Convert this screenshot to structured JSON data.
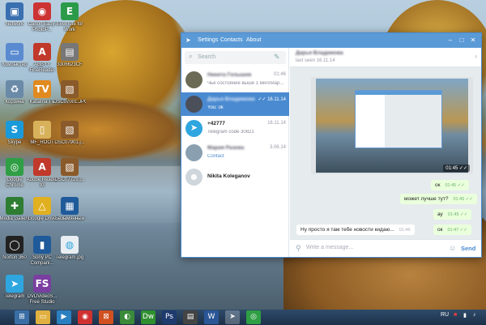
{
  "desktop": {
    "icons": [
      {
        "label": "Network",
        "color": "#3a6fb0",
        "glyph": "▣"
      },
      {
        "label": "Canon Easy-PhotoP...",
        "color": "#c33",
        "glyph": "◉"
      },
      {
        "label": "Evernote for Work",
        "color": "#2b9b4a",
        "glyph": "E"
      },
      {
        "label": "Компьютер",
        "color": "#5a8ad0",
        "glyph": "▭"
      },
      {
        "label": "ABBYY FineReader",
        "color": "#c0392b",
        "glyph": "A"
      },
      {
        "label": "3306623CF",
        "color": "#777",
        "glyph": "▤"
      },
      {
        "label": "Корзина",
        "color": "#6a8aa8",
        "glyph": "♻"
      },
      {
        "label": "Katalina TV",
        "color": "#e08a20",
        "glyph": "TV"
      },
      {
        "label": "DSC07001.JPG",
        "color": "#8a5a2a",
        "glyph": "▧"
      },
      {
        "label": "Skype",
        "color": "#1a9ad9",
        "glyph": "S"
      },
      {
        "label": "MF_ROOT",
        "color": "#d8b25a",
        "glyph": "▯"
      },
      {
        "label": "DSC07901.j...",
        "color": "#8a5a2a",
        "glyph": "▧"
      },
      {
        "label": "Google Chrome",
        "color": "#2f9e44",
        "glyph": "◎"
      },
      {
        "label": "Adobe Reader XI",
        "color": "#c0392b",
        "glyph": "A"
      },
      {
        "label": "DSC07729.j...",
        "color": "#8a5a2a",
        "glyph": "▧"
      },
      {
        "label": "Media Gallery",
        "color": "#2e7d32",
        "glyph": "✚"
      },
      {
        "label": "Google Drive",
        "color": "#e0b020",
        "glyph": "△"
      },
      {
        "label": "Безымянный",
        "color": "#1f5a9a",
        "glyph": "▦"
      },
      {
        "label": "Norton 360",
        "color": "#222",
        "glyph": "◯"
      },
      {
        "label": "Sony PC Compani...",
        "color": "#1f5a9a",
        "glyph": "▮"
      },
      {
        "label": "Telegram.jpg",
        "color": "#e9eef3",
        "glyph": "◍"
      },
      {
        "label": "Telegram",
        "color": "#2ea6e0",
        "glyph": "➤"
      },
      {
        "label": "DVDVideoS... Free Studio",
        "color": "#7a3fa0",
        "glyph": "FS"
      }
    ]
  },
  "window": {
    "menu": [
      "Settings",
      "Contacts",
      "About"
    ],
    "controls": [
      "–",
      "□",
      "✕"
    ],
    "search_placeholder": "Search",
    "chats": [
      {
        "name": "Никита Голышев",
        "preview": "Чье состояние выше 1 миллиар...",
        "time": "01:46",
        "avatar": "#6b6b55"
      },
      {
        "name": "Дарья Владимова",
        "preview": "You: ok",
        "time": "16.11.14",
        "avatar": "#4a4f5a"
      },
      {
        "name": "+42777",
        "preview": "Telegram code 30821",
        "time": "16.11.14",
        "avatar": "#2ea6e0"
      },
      {
        "name": "Мария Разова",
        "preview": "Contact",
        "time": "3.06.14",
        "avatar": "#8aa0b0"
      },
      {
        "name": "Nikita Koleganov",
        "preview": "",
        "time": "",
        "avatar": "#cfd6dc"
      }
    ],
    "active_chat": {
      "name": "Дарья Владимова",
      "status": "last seen 16.11.14"
    },
    "messages": [
      {
        "text": "",
        "time": "01:45",
        "type": "photo"
      },
      {
        "text": "ок",
        "time": "01:45",
        "type": "out"
      },
      {
        "text": "может лучше тут?",
        "time": "01:45",
        "type": "out"
      },
      {
        "text": "ау",
        "time": "01:45",
        "type": "out"
      },
      {
        "text": "Ну просто я там тебе новости кидаю...",
        "time": "01:46",
        "type": "in"
      },
      {
        "text": "ок",
        "time": "01:47",
        "type": "out"
      }
    ],
    "composer": {
      "placeholder": "Write a message...",
      "send_label": "Send"
    }
  },
  "taskbar": {
    "buttons": [
      {
        "glyph": "⊞",
        "color": "#3a6ea5"
      },
      {
        "glyph": "▭",
        "color": "#e0b040"
      },
      {
        "glyph": "▶",
        "color": "#2a7fc0"
      },
      {
        "glyph": "◉",
        "color": "#d03030"
      },
      {
        "glyph": "⊠",
        "color": "#d05020"
      },
      {
        "glyph": "◐",
        "color": "#3a8a3a"
      },
      {
        "glyph": "Dw",
        "color": "#2f8f2f"
      },
      {
        "glyph": "Ps",
        "color": "#1e3a6e"
      },
      {
        "glyph": "▤",
        "color": "#444"
      },
      {
        "glyph": "W",
        "color": "#2b5797"
      },
      {
        "glyph": "➤",
        "color": "#2ea6e0"
      },
      {
        "glyph": "◎",
        "color": "#2f9e44"
      }
    ],
    "language": "RU"
  },
  "colors": {
    "accent": "#4a8ad0",
    "title_bar": "#5a9ad7",
    "outgoing_bubble": "#eaffdc"
  }
}
